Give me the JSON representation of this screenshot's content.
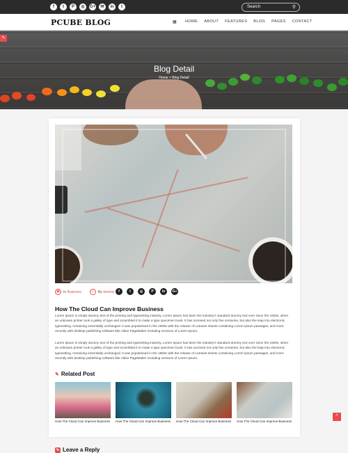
{
  "topbar": {
    "social_icons": [
      {
        "name": "facebook-icon",
        "glyph": "f"
      },
      {
        "name": "twitter-icon",
        "glyph": "t"
      },
      {
        "name": "pinterest-icon",
        "glyph": "P"
      },
      {
        "name": "instagram-icon",
        "glyph": "◎"
      },
      {
        "name": "google-plus-icon",
        "glyph": "G+"
      },
      {
        "name": "mail-icon",
        "glyph": "✉"
      },
      {
        "name": "linkedin-icon",
        "glyph": "in"
      },
      {
        "name": "tumblr-icon",
        "glyph": "t"
      }
    ],
    "search_placeholder": "Search"
  },
  "navbar": {
    "logo": "PCUBE BLOG",
    "menu": [
      "HOME",
      "ABOUT",
      "FEATURES",
      "BLOG",
      "PAGES",
      "CONTACT"
    ]
  },
  "hero": {
    "title": "Blog Detail",
    "breadcrumb_home": "Home",
    "breadcrumb_sep": ">",
    "breadcrumb_current": "Blog Detail"
  },
  "post": {
    "category_prefix": "In",
    "category": "Business",
    "author_prefix": "By",
    "author": "dummy",
    "share_icons": [
      {
        "name": "facebook-icon",
        "glyph": "f"
      },
      {
        "name": "twitter-icon",
        "glyph": "t"
      },
      {
        "name": "instagram-icon",
        "glyph": "◎"
      },
      {
        "name": "pinterest-icon",
        "glyph": "P"
      },
      {
        "name": "linkedin-icon",
        "glyph": "in"
      },
      {
        "name": "google-plus-icon",
        "glyph": "G+"
      }
    ],
    "title": "How The Cloud Can Improve Business",
    "paragraphs": [
      "Lorem Ipsum is simply dummy text of the printing and typesetting industry. Lorem Ipsum has been the industry's standard dummy text ever since the 1500s, when an unknown printer took a galley of type and scrambled it to make a type specimen book. It has survived not only five centuries, but also the leap into electronic typesetting, remaining essentially unchanged. It was popularised in the 1960s with the release of Letraset sheets containing Lorem Ipsum passages, and more recently with desktop publishing software like Aldus PageMaker including versions of Lorem Ipsum.",
      "Lorem Ipsum is simply dummy text of the printing and typesetting industry. Lorem Ipsum has been the industry's standard dummy text ever since the 1500s, when an unknown printer took a galley of type and scrambled it to make a type specimen book. It has survived not only five centuries, but also the leap into electronic typesetting, remaining essentially unchanged. It was popularised in the 1960s with the release of Letraset sheets containing Lorem Ipsum passages, and more recently with desktop publishing software like Aldus PageMaker including versions of Lorem Ipsum."
    ]
  },
  "related": {
    "heading": "Related Post",
    "items": [
      {
        "caption": "How The Cloud Can Improve Business"
      },
      {
        "caption": "How The Cloud Can Improve Business"
      },
      {
        "caption": "How The Cloud Can Improve Business"
      },
      {
        "caption": "How The Cloud Can Improve Business"
      }
    ]
  },
  "comments": {
    "heading": "Leave a Reply"
  },
  "colors": {
    "accent": "#e74c4c",
    "topbar": "#2b2b2b"
  }
}
